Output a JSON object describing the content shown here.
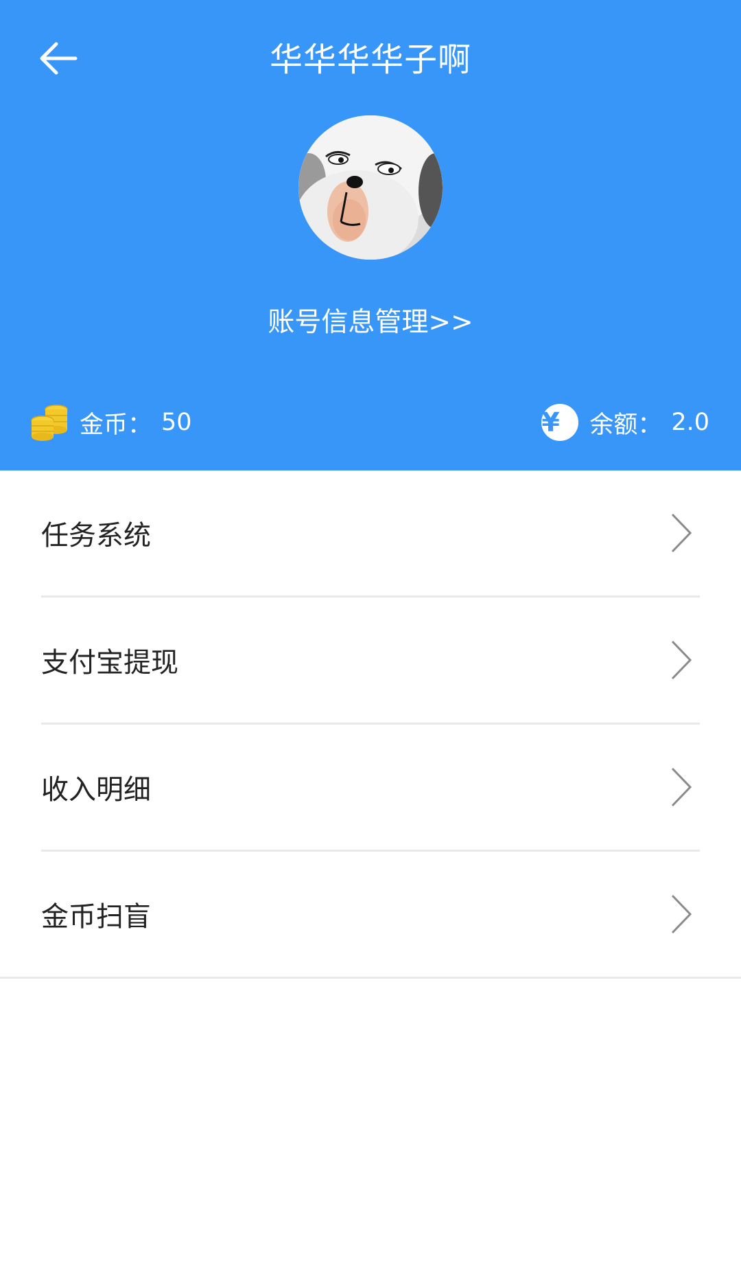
{
  "header": {
    "title": "华华华华子啊",
    "account_link": "账号信息管理>>",
    "background_color": "#3796f8"
  },
  "stats": {
    "coins": {
      "label": "金币：",
      "value": "50",
      "icon": "coins-icon"
    },
    "balance": {
      "label": "余额：",
      "value": "2.0",
      "icon": "yuan-icon",
      "symbol": "¥"
    }
  },
  "menu": {
    "items": [
      {
        "label": "任务系统"
      },
      {
        "label": "支付宝提现"
      },
      {
        "label": "收入明细"
      },
      {
        "label": "金币扫盲"
      }
    ]
  }
}
